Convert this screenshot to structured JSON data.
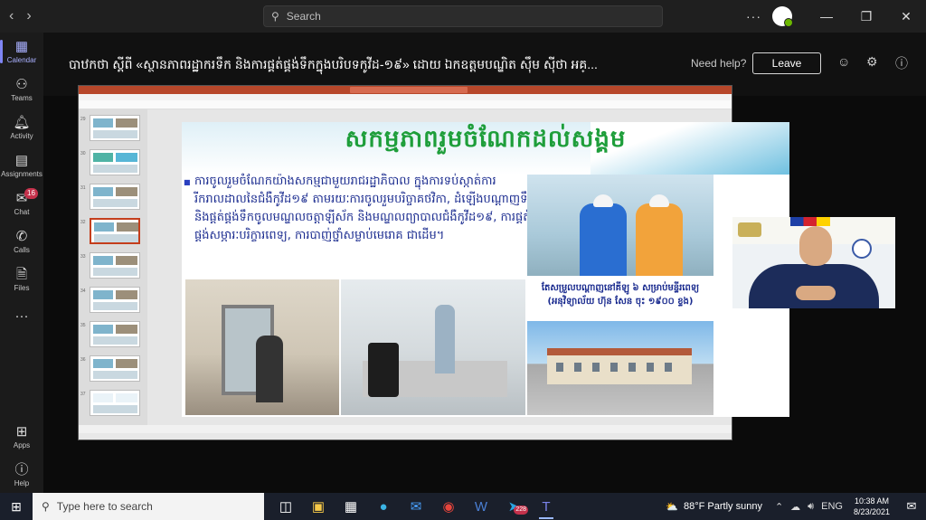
{
  "titlebar": {
    "search_placeholder": "Search",
    "more_label": "···",
    "avatar_label": "Pro"
  },
  "rail": {
    "items": [
      {
        "label": "Calendar",
        "icon": "calendar-icon"
      },
      {
        "label": "Teams",
        "icon": "teams-icon"
      },
      {
        "label": "Activity",
        "icon": "bell-icon"
      },
      {
        "label": "Assignments",
        "icon": "assignments-icon"
      },
      {
        "label": "Chat",
        "icon": "chat-icon",
        "badge": "16"
      },
      {
        "label": "Calls",
        "icon": "phone-icon"
      },
      {
        "label": "Files",
        "icon": "files-icon"
      },
      {
        "label": "···",
        "icon": "more-icon"
      },
      {
        "label": "Apps",
        "icon": "apps-icon"
      },
      {
        "label": "Help",
        "icon": "help-icon"
      }
    ]
  },
  "meeting": {
    "title": "បាឋកថា ស្ដីពី «ស្ថានភាពរដ្ឋាករទឹក និងការផ្គត់ផ្គង់ទឹកក្នុងបរិបទកូវីដ-១៩» ដោយ ឯកឧត្តមបណ្ឌិត ស៊ឹម ស៊ីថា អគ្...",
    "need_help": "Need help?",
    "leave": "Leave"
  },
  "slide": {
    "title": "សកម្មភាពរួមចំណែកដល់សង្គម",
    "bullet": "ការចូលរួមចំណែកយ៉ាងសកម្មជាមួយរាជរដ្ឋាភិបាល ក្នុងការទប់ស្កាត់ការរីករាលដាលនៃជំងឺកូវីដ១៩ តាមរយៈការចូលរួមបរិច្ចាគថវិកា, ដំឡើងបណ្ដាញទឹកនិងផ្គត់ផ្គង់ទឹកចូលមណ្ឌលចត្តាឡីស័ក និងមណ្ឌលព្យាបាលជំងឺកូវីដ១៩, ការផ្គត់ផ្គង់សម្ភារៈបរិក្ខារពេទ្យ, ការបាញ់ថ្នាំសម្លាប់មេរោគ ជាដើម។",
    "caption": "តែសម្រួលបណ្ដាញនៅគីឡូ ៦ សម្រាប់មន្ទីរពេទ្យ (អនុវិទ្យាល័យ ហ៊ុន សែន ចុះ ១៩០០ ខ្ទង)"
  },
  "thumbnails": [
    {
      "num": "29"
    },
    {
      "num": "30"
    },
    {
      "num": "31"
    },
    {
      "num": "32",
      "selected": true
    },
    {
      "num": "33"
    },
    {
      "num": "34"
    },
    {
      "num": "35"
    },
    {
      "num": "36"
    },
    {
      "num": "37"
    }
  ],
  "taskbar": {
    "search_placeholder": "Type here to search",
    "telegram_badge": "228",
    "weather": "88°F  Partly sunny",
    "language": "ENG",
    "time": "10:38 AM",
    "date": "8/23/2021"
  }
}
